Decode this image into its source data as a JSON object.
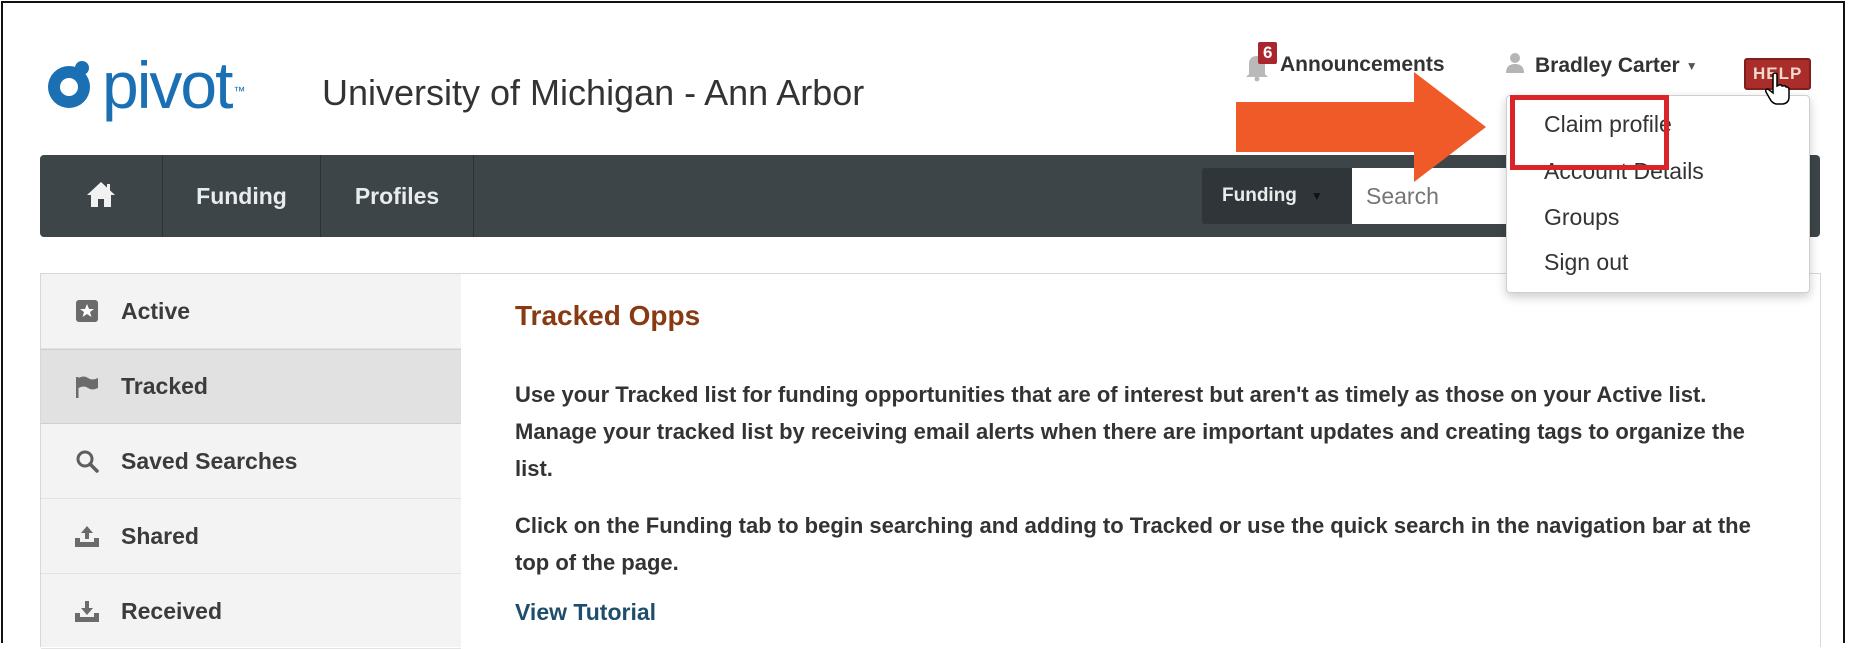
{
  "header": {
    "logo_text": "pivot",
    "logo_tm": "™",
    "institution": "University of Michigan - Ann Arbor",
    "announcements_label": "Announcements",
    "announcements_count": "6",
    "user_name": "Bradley Carter",
    "help_label": "HELP"
  },
  "navbar": {
    "items": [
      {
        "label": "Funding"
      },
      {
        "label": "Profiles"
      }
    ],
    "search_scope": "Funding",
    "search_placeholder": "Search"
  },
  "user_menu": {
    "items": [
      {
        "label": "Claim profile"
      },
      {
        "label": "Account Details"
      },
      {
        "label": "Groups"
      },
      {
        "label": "Sign out"
      }
    ],
    "highlighted_item": "Claim profile"
  },
  "sidebar": {
    "items": [
      {
        "label": "Active",
        "icon": "star-icon"
      },
      {
        "label": "Tracked",
        "icon": "flag-icon",
        "selected": true
      },
      {
        "label": "Saved Searches",
        "icon": "search-icon"
      },
      {
        "label": "Shared",
        "icon": "share-icon"
      },
      {
        "label": "Received",
        "icon": "inbox-icon"
      }
    ]
  },
  "main": {
    "title": "Tracked Opps",
    "paragraph1": "Use your Tracked list for funding opportunities that are of interest but aren't as timely as those on your Active list. Manage your tracked list by receiving email alerts when there are important updates and creating tags to organize the list.",
    "paragraph2": "Click on the Funding tab to begin searching and adding to Tracked or use the quick search in the navigation bar at the top of the page.",
    "tutorial_link": "View Tutorial"
  },
  "colors": {
    "brand_blue": "#1b6fb3",
    "nav_bg": "#3d4549",
    "title_brown": "#8a3a12",
    "highlight_red": "#d9252a",
    "arrow_orange": "#f05a28"
  }
}
